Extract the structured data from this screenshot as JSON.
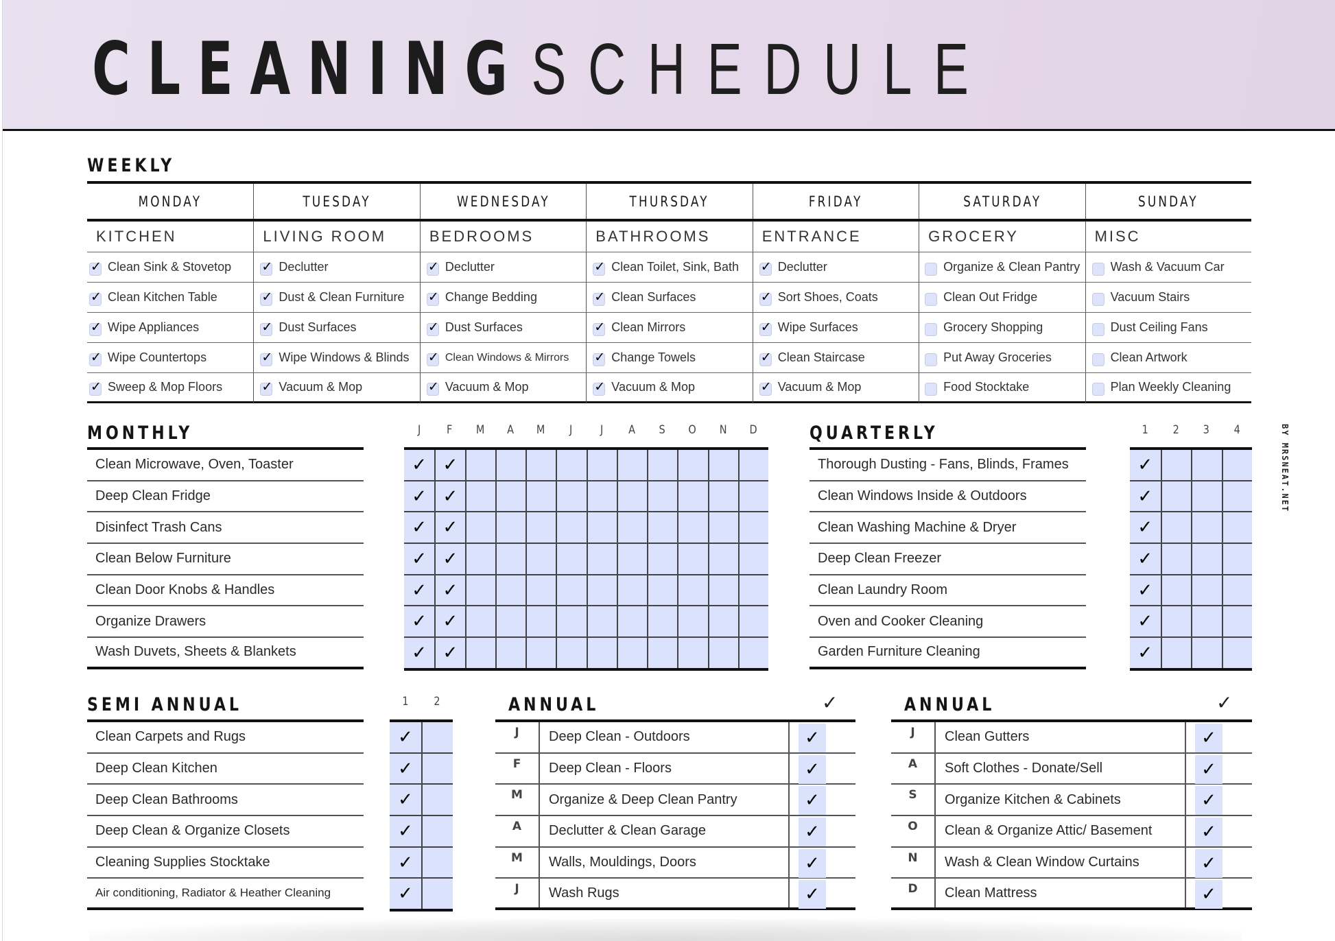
{
  "header": {
    "title_bold": "CLEANING",
    "title_light": "SCHEDULE"
  },
  "credit": "BY MRSNEAT.NET",
  "colors": {
    "header_bg": "#e5d9ea",
    "check_fill": "#dbe2fb",
    "rule": "#111111"
  },
  "weekly": {
    "title": "WEEKLY",
    "days": [
      {
        "day": "MONDAY",
        "category": "KITCHEN",
        "tasks": [
          {
            "label": "Clean Sink & Stovetop",
            "checked": true
          },
          {
            "label": "Clean Kitchen Table",
            "checked": true
          },
          {
            "label": "Wipe Appliances",
            "checked": true
          },
          {
            "label": "Wipe Countertops",
            "checked": true
          },
          {
            "label": "Sweep & Mop Floors",
            "checked": true
          }
        ]
      },
      {
        "day": "TUESDAY",
        "category": "LIVING ROOM",
        "tasks": [
          {
            "label": "Declutter",
            "checked": true
          },
          {
            "label": "Dust & Clean Furniture",
            "checked": true
          },
          {
            "label": "Dust Surfaces",
            "checked": true
          },
          {
            "label": "Wipe Windows & Blinds",
            "checked": true
          },
          {
            "label": "Vacuum & Mop",
            "checked": true
          }
        ]
      },
      {
        "day": "WEDNESDAY",
        "category": "BEDROOMS",
        "tasks": [
          {
            "label": "Declutter",
            "checked": true
          },
          {
            "label": "Change Bedding",
            "checked": true
          },
          {
            "label": "Dust Surfaces",
            "checked": true
          },
          {
            "label": "Clean Windows & Mirrors",
            "checked": true
          },
          {
            "label": "Vacuum & Mop",
            "checked": true
          }
        ]
      },
      {
        "day": "THURSDAY",
        "category": "BATHROOMS",
        "tasks": [
          {
            "label": "Clean Toilet, Sink, Bath",
            "checked": true
          },
          {
            "label": "Clean Surfaces",
            "checked": true
          },
          {
            "label": "Clean Mirrors",
            "checked": true
          },
          {
            "label": "Change Towels",
            "checked": true
          },
          {
            "label": "Vacuum & Mop",
            "checked": true
          }
        ]
      },
      {
        "day": "FRIDAY",
        "category": "ENTRANCE",
        "tasks": [
          {
            "label": "Declutter",
            "checked": true
          },
          {
            "label": "Sort Shoes, Coats",
            "checked": true
          },
          {
            "label": "Wipe Surfaces",
            "checked": true
          },
          {
            "label": "Clean Staircase",
            "checked": true
          },
          {
            "label": "Vacuum & Mop",
            "checked": true
          }
        ]
      },
      {
        "day": "SATURDAY",
        "category": "GROCERY",
        "tasks": [
          {
            "label": "Organize & Clean Pantry",
            "checked": false
          },
          {
            "label": "Clean Out Fridge",
            "checked": false
          },
          {
            "label": "Grocery Shopping",
            "checked": false
          },
          {
            "label": "Put Away Groceries",
            "checked": false
          },
          {
            "label": "Food Stocktake",
            "checked": false
          }
        ]
      },
      {
        "day": "SUNDAY",
        "category": "MISC",
        "tasks": [
          {
            "label": "Wash & Vacuum Car",
            "checked": false
          },
          {
            "label": "Vacuum Stairs",
            "checked": false
          },
          {
            "label": "Dust Ceiling Fans",
            "checked": false
          },
          {
            "label": "Clean Artwork",
            "checked": false
          },
          {
            "label": "Plan Weekly Cleaning",
            "checked": false
          }
        ]
      }
    ]
  },
  "monthly": {
    "title": "MONTHLY",
    "columns": [
      "J",
      "F",
      "M",
      "A",
      "M",
      "J",
      "J",
      "A",
      "S",
      "O",
      "N",
      "D"
    ],
    "check_glyph": "✓",
    "tasks": [
      {
        "label": "Clean Microwave, Oven, Toaster",
        "done": [
          true,
          true,
          false,
          false,
          false,
          false,
          false,
          false,
          false,
          false,
          false,
          false
        ]
      },
      {
        "label": "Deep Clean Fridge",
        "done": [
          true,
          true,
          false,
          false,
          false,
          false,
          false,
          false,
          false,
          false,
          false,
          false
        ]
      },
      {
        "label": "Disinfect Trash Cans",
        "done": [
          true,
          true,
          false,
          false,
          false,
          false,
          false,
          false,
          false,
          false,
          false,
          false
        ]
      },
      {
        "label": "Clean Below Furniture",
        "done": [
          true,
          true,
          false,
          false,
          false,
          false,
          false,
          false,
          false,
          false,
          false,
          false
        ]
      },
      {
        "label": "Clean Door Knobs & Handles",
        "done": [
          true,
          true,
          false,
          false,
          false,
          false,
          false,
          false,
          false,
          false,
          false,
          false
        ]
      },
      {
        "label": "Organize Drawers",
        "done": [
          true,
          true,
          false,
          false,
          false,
          false,
          false,
          false,
          false,
          false,
          false,
          false
        ]
      },
      {
        "label": "Wash Duvets, Sheets & Blankets",
        "done": [
          true,
          true,
          false,
          false,
          false,
          false,
          false,
          false,
          false,
          false,
          false,
          false
        ]
      }
    ]
  },
  "quarterly": {
    "title": "QUARTERLY",
    "columns": [
      "1",
      "2",
      "3",
      "4"
    ],
    "tasks": [
      {
        "label": "Thorough Dusting -  Fans, Blinds, Frames",
        "done": [
          true,
          false,
          false,
          false
        ]
      },
      {
        "label": "Clean Windows Inside & Outdoors",
        "done": [
          true,
          false,
          false,
          false
        ]
      },
      {
        "label": "Clean Washing Machine & Dryer",
        "done": [
          true,
          false,
          false,
          false
        ]
      },
      {
        "label": "Deep Clean Freezer",
        "done": [
          true,
          false,
          false,
          false
        ]
      },
      {
        "label": "Clean Laundry Room",
        "done": [
          true,
          false,
          false,
          false
        ]
      },
      {
        "label": "Oven and Cooker Cleaning",
        "done": [
          true,
          false,
          false,
          false
        ]
      },
      {
        "label": "Garden Furniture Cleaning",
        "done": [
          true,
          false,
          false,
          false
        ]
      }
    ]
  },
  "semi_annual": {
    "title": "SEMI ANNUAL",
    "columns": [
      "1",
      "2"
    ],
    "tasks": [
      {
        "label": "Clean Carpets and Rugs",
        "done": [
          true,
          false
        ]
      },
      {
        "label": "Deep Clean Kitchen",
        "done": [
          true,
          false
        ]
      },
      {
        "label": "Deep Clean Bathrooms",
        "done": [
          true,
          false
        ]
      },
      {
        "label": "Deep Clean & Organize Closets",
        "done": [
          true,
          false
        ]
      },
      {
        "label": "Cleaning Supplies Stocktake",
        "done": [
          true,
          false
        ]
      },
      {
        "label": "Air conditioning, Radiator & Heather Cleaning",
        "done": [
          true,
          false
        ]
      }
    ]
  },
  "annual": [
    {
      "title": "ANNUAL",
      "check_header": "✓",
      "tasks": [
        {
          "month": "J",
          "label": "Deep Clean - Outdoors",
          "done": true
        },
        {
          "month": "F",
          "label": "Deep Clean - Floors",
          "done": true
        },
        {
          "month": "M",
          "label": "Organize & Deep Clean Pantry",
          "done": true
        },
        {
          "month": "A",
          "label": "Declutter & Clean Garage",
          "done": true
        },
        {
          "month": "M",
          "label": "Walls, Mouldings, Doors",
          "done": true
        },
        {
          "month": "J",
          "label": "Wash Rugs",
          "done": true
        }
      ]
    },
    {
      "title": "ANNUAL",
      "check_header": "✓",
      "tasks": [
        {
          "month": "J",
          "label": "Clean Gutters",
          "done": true
        },
        {
          "month": "A",
          "label": "Soft Clothes - Donate/Sell",
          "done": true
        },
        {
          "month": "S",
          "label": "Organize Kitchen & Cabinets",
          "done": true
        },
        {
          "month": "O",
          "label": "Clean & Organize Attic/ Basement",
          "done": true
        },
        {
          "month": "N",
          "label": "Wash & Clean Window Curtains",
          "done": true
        },
        {
          "month": "D",
          "label": "Clean Mattress",
          "done": true
        }
      ]
    }
  ]
}
